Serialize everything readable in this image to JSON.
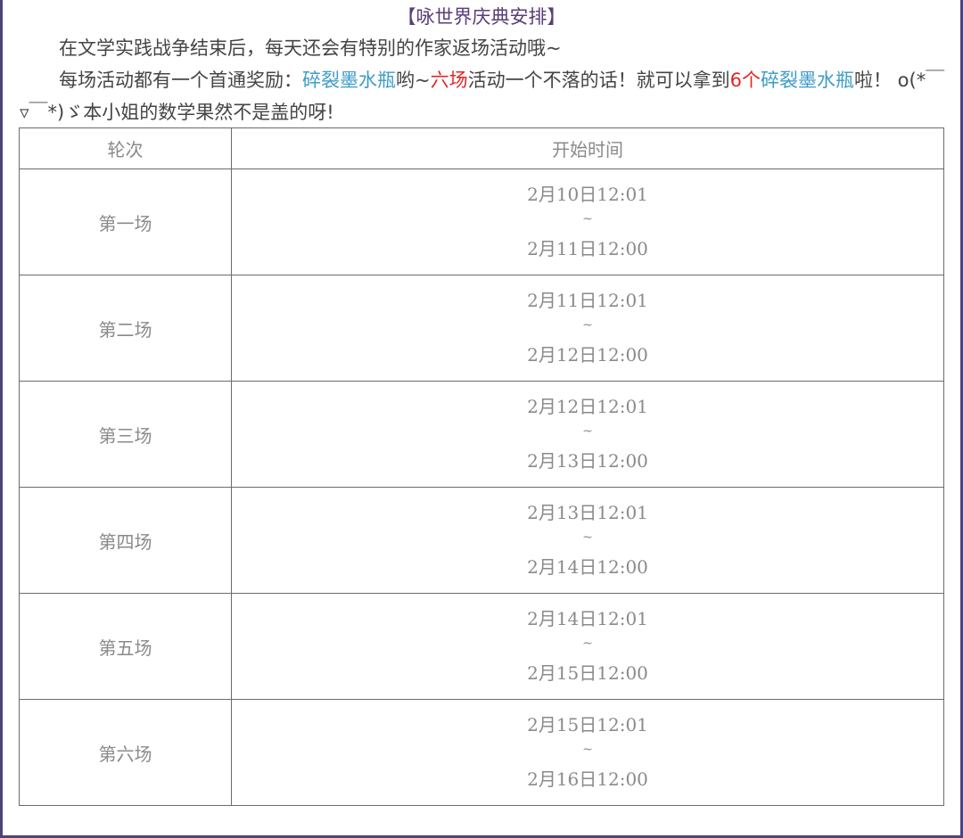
{
  "title": "【咏世界庆典安排】",
  "intro": {
    "line1": "在文学实践战争结束后，每天还会有特别的作家返场活动哦~",
    "line2": {
      "part1": "每场活动都有一个首通奖励：",
      "item": "碎裂墨水瓶",
      "part2": "哟~",
      "six_rounds": "六场",
      "part3": "活动一个不落的话！就可以拿到",
      "six_count": "6个",
      "item2": "碎裂墨水瓶",
      "part4": "啦！ o(*￣▿￣*)ゞ本小姐的数学果然不是盖的呀!"
    }
  },
  "colors": {
    "title": "#5b3d77",
    "item_blue": "#3e9bc8",
    "highlight_red": "#e32626",
    "table_text": "#8a8a8a",
    "frame": "#4e4479"
  },
  "table": {
    "headers": [
      "轮次",
      "开始时间"
    ],
    "rows": [
      {
        "round": "第一场",
        "start": "2月10日12:01",
        "sep": "~",
        "end": "2月11日12:00"
      },
      {
        "round": "第二场",
        "start": "2月11日12:01",
        "sep": "~",
        "end": "2月12日12:00"
      },
      {
        "round": "第三场",
        "start": "2月12日12:01",
        "sep": "~",
        "end": "2月13日12:00"
      },
      {
        "round": "第四场",
        "start": "2月13日12:01",
        "sep": "~",
        "end": "2月14日12:00"
      },
      {
        "round": "第五场",
        "start": "2月14日12:01",
        "sep": "~",
        "end": "2月15日12:00"
      },
      {
        "round": "第六场",
        "start": "2月15日12:01",
        "sep": "~",
        "end": "2月16日12:00"
      }
    ]
  }
}
